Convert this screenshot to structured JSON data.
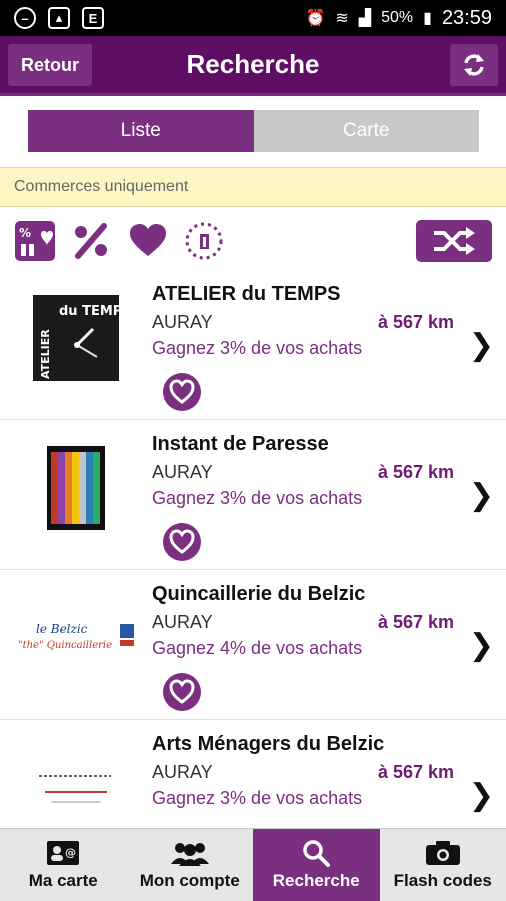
{
  "status_bar": {
    "battery": "50%",
    "time": "23:59"
  },
  "header": {
    "back_label": "Retour",
    "title": "Recherche",
    "refresh_icon": "refresh-icon"
  },
  "view_toggle": {
    "list_label": "Liste",
    "map_label": "Carte",
    "selected": "Liste"
  },
  "filter_notice": "Commerces uniquement",
  "filters": {
    "icons": [
      "offers-favorites-icon",
      "percent-icon",
      "heart-icon",
      "new-icon"
    ],
    "shuffle_icon": "shuffle-icon"
  },
  "colors": {
    "primary": "#5e0f63",
    "accent": "#7b2f80",
    "notice_bg": "#fdf6c3"
  },
  "shops": [
    {
      "name": "ATELIER du TEMPS",
      "city": "AURAY",
      "distance": "à 567 km",
      "reward": "Gagnez 3% de vos achats",
      "logo_text_1": "du TEMPS",
      "logo_text_2": "ATELIER"
    },
    {
      "name": "Instant de Paresse",
      "city": "AURAY",
      "distance": "à 567 km",
      "reward": "Gagnez 3% de vos achats"
    },
    {
      "name": "Quincaillerie du Belzic",
      "city": "AURAY",
      "distance": "à 567 km",
      "reward": "Gagnez 4% de vos achats",
      "logo_text_1": "le Belzic",
      "logo_text_2": "\"the\" Quincaillerie"
    },
    {
      "name": "Arts Ménagers du Belzic",
      "city": "AURAY",
      "distance": "à 567 km",
      "reward": "Gagnez 3% de vos achats"
    }
  ],
  "bottom_nav": [
    {
      "label": "Ma carte",
      "icon": "card-icon"
    },
    {
      "label": "Mon compte",
      "icon": "users-icon"
    },
    {
      "label": "Recherche",
      "icon": "search-icon",
      "active": true
    },
    {
      "label": "Flash codes",
      "icon": "camera-icon"
    }
  ]
}
